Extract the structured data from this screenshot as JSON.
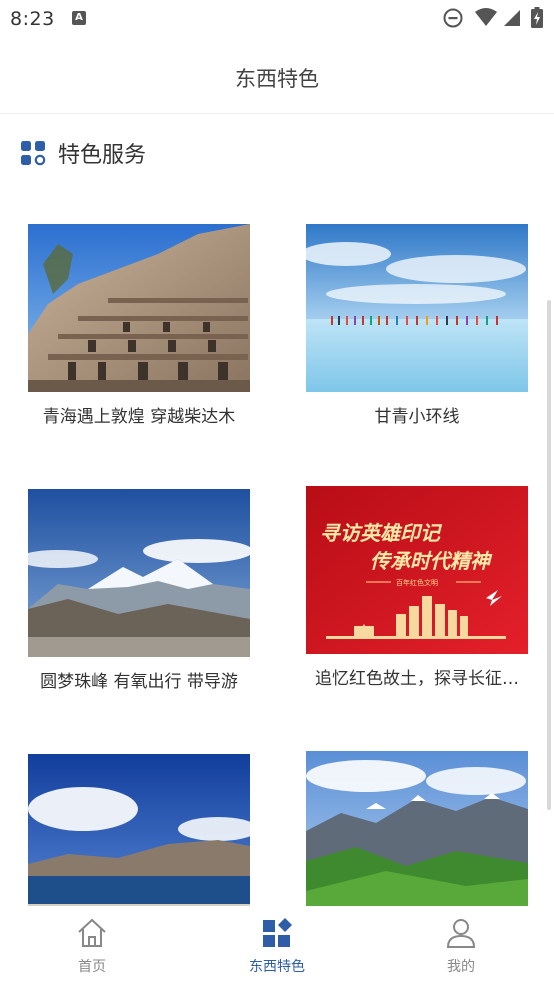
{
  "status_bar": {
    "time": "8:23",
    "notification_icon": "keyboard-a-icon"
  },
  "header": {
    "title": "东西特色"
  },
  "section": {
    "title": "特色服务",
    "icon": "grid-apps-icon",
    "accent": "#2f5ea8"
  },
  "cards": [
    {
      "caption": "青海遇上敦煌 穿越柴达木"
    },
    {
      "caption": "甘青小环线"
    },
    {
      "caption": "圆梦珠峰 有氧出行 带导游"
    },
    {
      "caption": "追忆红色故土，探寻长征…",
      "poster_line1": "寻访英雄印记",
      "poster_line2": "传承时代精神",
      "poster_sub": "百年红色文明"
    },
    {
      "caption": ""
    },
    {
      "caption": ""
    }
  ],
  "tabs": [
    {
      "label": "首页",
      "icon": "home-icon",
      "active": false
    },
    {
      "label": "东西特色",
      "icon": "category-grid-icon",
      "active": true
    },
    {
      "label": "我的",
      "icon": "person-icon",
      "active": false
    }
  ],
  "colors": {
    "active": "#2f5ea8",
    "inactive": "#888888",
    "poster_red": "#c8101a"
  }
}
